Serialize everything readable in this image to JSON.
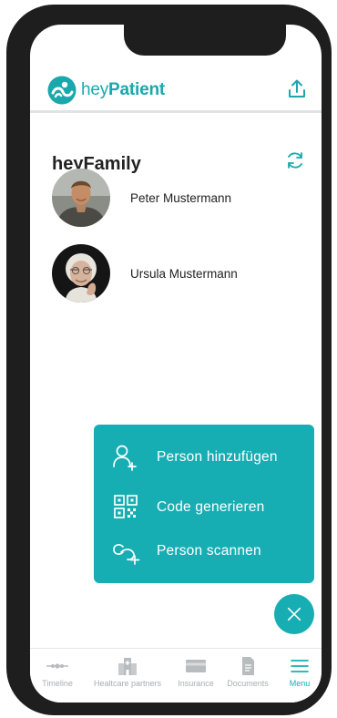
{
  "app": {
    "logo_prefix": "hey",
    "logo_suffix": "Patient",
    "brand_color": "#1aa8ad",
    "accent_color": "#17aeb3"
  },
  "header": {
    "upload_icon": "upload-icon"
  },
  "family": {
    "title": "heyFamily",
    "refresh_icon": "refresh-icon",
    "people": [
      {
        "name": "Peter Mustermann"
      },
      {
        "name": "Ursula Mustermann"
      }
    ]
  },
  "add_menu": {
    "items": [
      {
        "label": "Person hinzufügen",
        "icon": "add-person-icon"
      },
      {
        "label": "Code generieren",
        "icon": "qr-code-icon"
      },
      {
        "label": "Person scannen",
        "icon": "scan-person-icon"
      }
    ],
    "close_icon": "close-icon"
  },
  "tabbar": {
    "tabs": [
      {
        "label": "Timeline",
        "icon": "timeline-icon",
        "active": false
      },
      {
        "label": "Healtcare partners",
        "icon": "hospital-icon",
        "active": false
      },
      {
        "label": "Insurance",
        "icon": "card-icon",
        "active": false
      },
      {
        "label": "Documents",
        "icon": "document-icon",
        "active": false
      },
      {
        "label": "Menu",
        "icon": "menu-icon",
        "active": true
      }
    ]
  }
}
